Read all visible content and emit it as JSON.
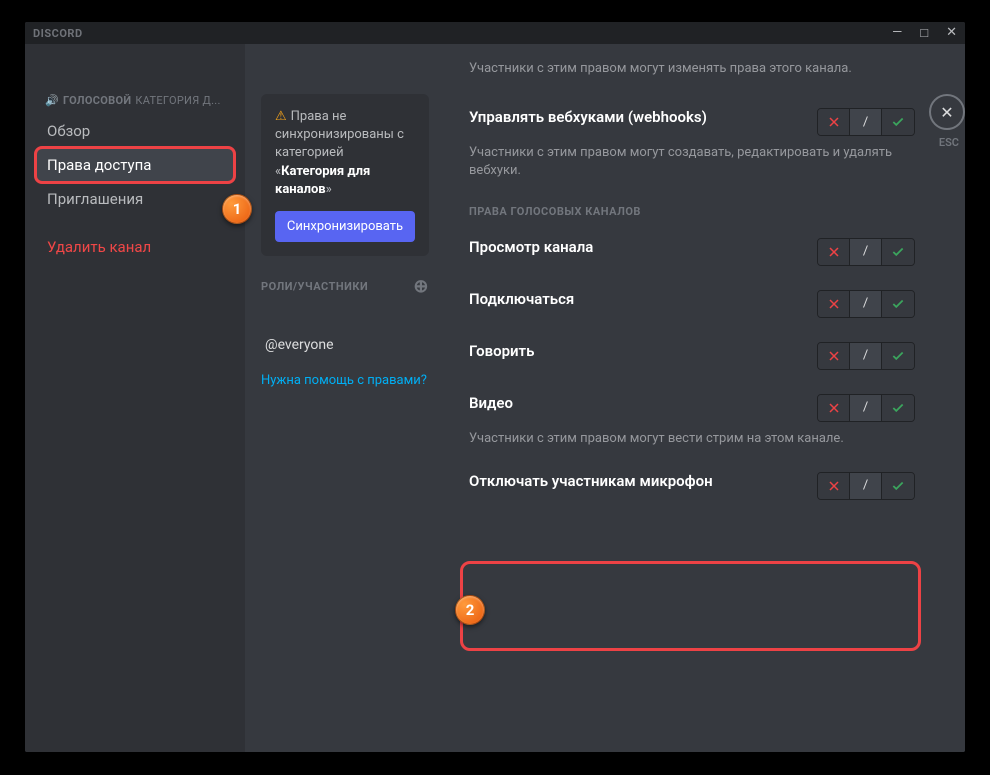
{
  "app": {
    "name": "DISCORD"
  },
  "titlebar": {
    "min": "—",
    "max": "□",
    "close": "✕"
  },
  "sidebar": {
    "header_icon": "🔊",
    "header": "ГОЛОСОВОЙ",
    "header_suffix": "КАТЕГОРИЯ Д...",
    "items": [
      {
        "label": "Обзор"
      },
      {
        "label": "Права доступа"
      },
      {
        "label": "Приглашения"
      }
    ],
    "delete": "Удалить канал"
  },
  "sync": {
    "warn": "⚠",
    "text_pre": "Права не синхронизированы с категорией «",
    "text_bold": "Категория для каналов",
    "text_post": "»",
    "button": "Синхронизировать"
  },
  "roles": {
    "header": "РОЛИ/УЧАСТНИКИ",
    "add": "⊕",
    "everyone": "@everyone",
    "help": "Нужна помощь с правами?"
  },
  "esc": {
    "icon": "✕",
    "label": "ESC"
  },
  "permissions": {
    "top_desc": "Участники с этим правом могут изменять права этого канала.",
    "webhooks": {
      "title": "Управлять вебхуками (webhooks)",
      "desc": "Участники с этим правом могут создавать, редактировать и удалять вебхуки."
    },
    "voice_section": "ПРАВА ГОЛОСОВЫХ КАНАЛОВ",
    "view": {
      "title": "Просмотр канала"
    },
    "connect": {
      "title": "Подключаться"
    },
    "speak": {
      "title": "Говорить"
    },
    "video": {
      "title": "Видео",
      "desc": "Участники с этим правом могут вести стрим на этом канале."
    },
    "mute": {
      "title": "Отключать участникам микрофон"
    }
  },
  "toggle": {
    "slash": "/"
  },
  "callouts": {
    "one": "1",
    "two": "2"
  }
}
